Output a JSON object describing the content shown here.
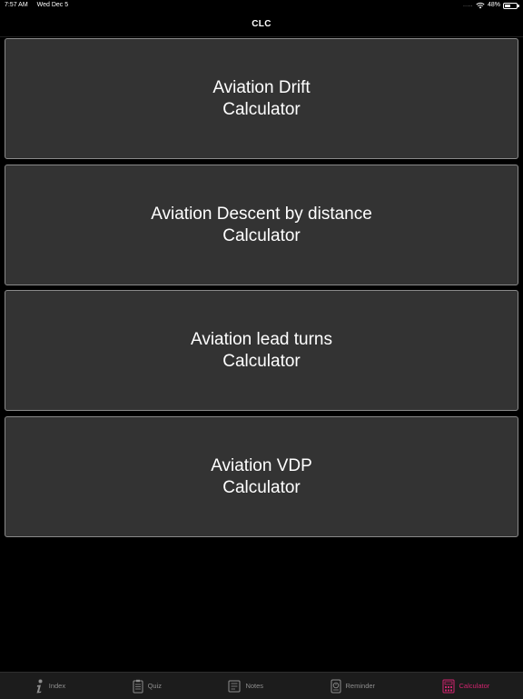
{
  "status_bar": {
    "time": "7:57 AM",
    "date": "Wed Dec 5",
    "signal": ".....",
    "battery_text": "48%",
    "battery_level": 0.48
  },
  "nav": {
    "title": "CLC"
  },
  "calculators": [
    {
      "line1": "Aviation Drift",
      "line2": "Calculator"
    },
    {
      "line1": "Aviation Descent by distance",
      "line2": "Calculator"
    },
    {
      "line1": "Aviation lead turns",
      "line2": "Calculator"
    },
    {
      "line1": "Aviation VDP",
      "line2": "Calculator"
    }
  ],
  "tabs": [
    {
      "label": "Index",
      "icon": "info-icon"
    },
    {
      "label": "Quiz",
      "icon": "clipboard-icon"
    },
    {
      "label": "Notes",
      "icon": "notes-icon"
    },
    {
      "label": "Reminder",
      "icon": "reminder-icon"
    },
    {
      "label": "Calculator",
      "icon": "calculator-icon",
      "active": true
    }
  ],
  "colors": {
    "accent": "#d0246e",
    "button_bg": "#333333",
    "tab_inactive": "#8e8e8e"
  }
}
